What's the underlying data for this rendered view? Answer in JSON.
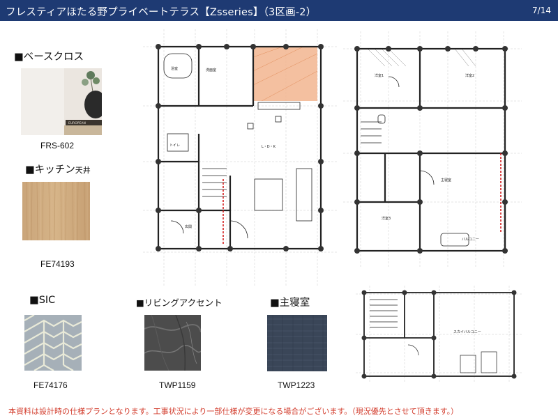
{
  "header": {
    "title": "フレスティアほたる野プライベートテラス【Zsseries】（3区画-2）",
    "page": "7/14"
  },
  "materials": [
    {
      "label": "■ベースクロス",
      "code": "FRS-602"
    },
    {
      "label": "■キッチン",
      "label_sub": "天井",
      "code": "FE74193"
    },
    {
      "label": "■SIC",
      "code": "FE74176"
    },
    {
      "label": "■リビングアクセント",
      "code": "TWP1159"
    },
    {
      "label": "■主寝室",
      "code": "TWP1223"
    }
  ],
  "photo_text": "EUROPEAN",
  "plans": {
    "first_floor": {
      "label_ldk": "L・D・K",
      "label_entrance": "玄関",
      "label_bath": "浴室",
      "label_wash": "洗面室",
      "label_toilet": "トイレ"
    },
    "second_floor": {
      "label_master": "主寝室",
      "label_room1": "洋室1",
      "label_room2": "洋室2",
      "label_room3": "洋室3",
      "label_balcony": "バルコニー"
    },
    "roof": {
      "label": "スカイバルコニー"
    }
  },
  "footer": "本資料は設計時の仕様プランとなります。工事状況により一部仕様が変更になる場合がございます。（現況優先とさせて頂きます。）"
}
